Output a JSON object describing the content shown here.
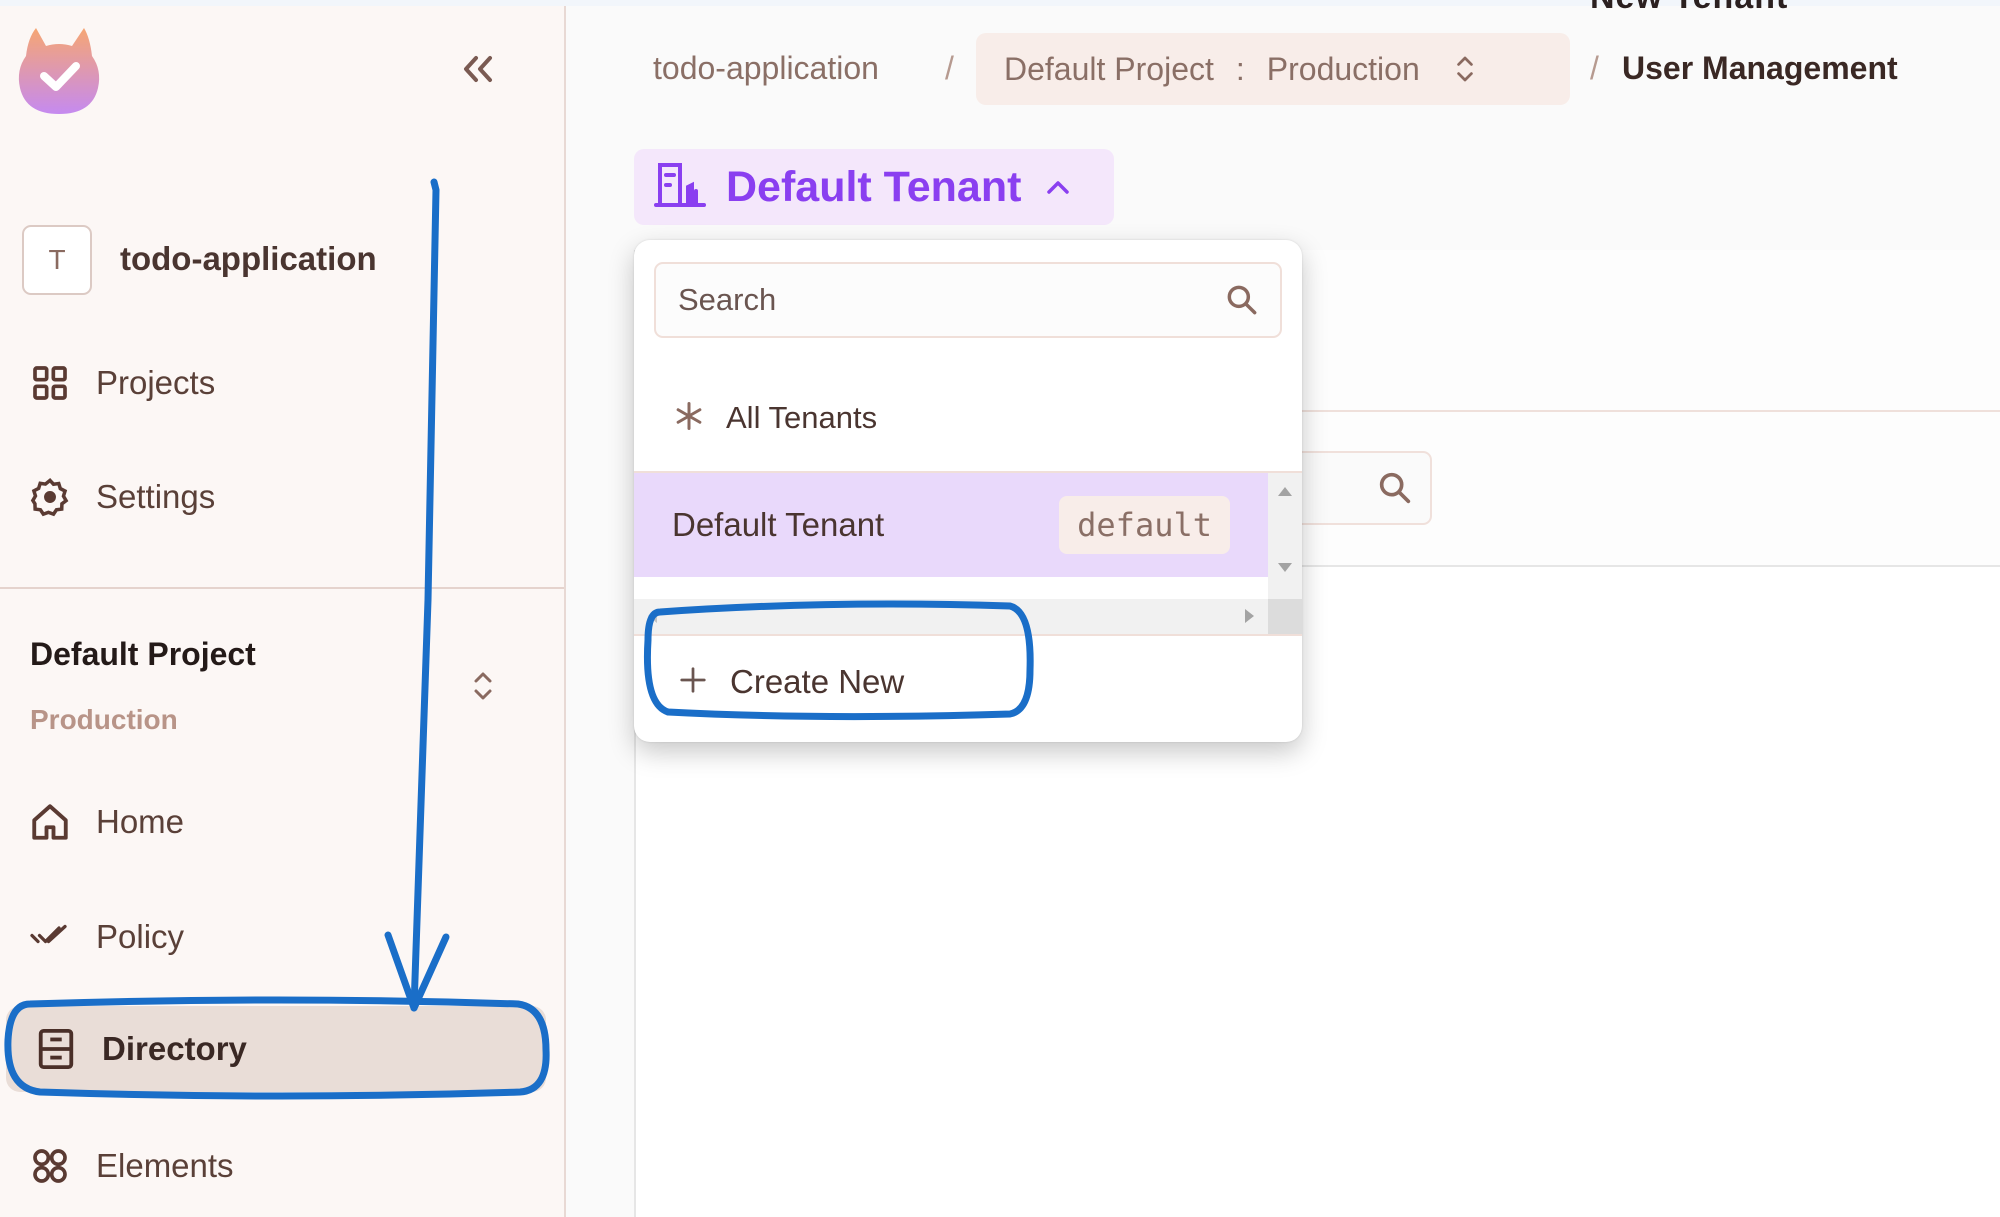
{
  "top_clipped_text": "New Tenant",
  "sidebar": {
    "collapse_icon": "double-chevron-left-icon",
    "org": {
      "avatar_letter": "T",
      "name": "todo-application"
    },
    "org_nav": [
      {
        "label": "Projects",
        "icon": "grid-icon"
      },
      {
        "label": "Settings",
        "icon": "gear-icon"
      }
    ],
    "project": {
      "name": "Default Project",
      "environment": "Production",
      "switch_icon": "chevron-up-down-icon"
    },
    "project_nav": [
      {
        "label": "Home",
        "icon": "home-icon",
        "active": false
      },
      {
        "label": "Policy",
        "icon": "double-check-icon",
        "active": false
      },
      {
        "label": "Directory",
        "icon": "cabinet-icon",
        "active": true
      },
      {
        "label": "Elements",
        "icon": "four-circles-icon",
        "active": false
      }
    ]
  },
  "breadcrumb": {
    "org": "todo-application",
    "separator": "/",
    "project": "Default Project",
    "colon": ":",
    "environment": "Production",
    "current": "User Management"
  },
  "tenant_selector": {
    "label": "Default Tenant",
    "icon": "building-icon",
    "expanded": true
  },
  "tenant_dropdown": {
    "search_placeholder": "Search",
    "all_option": "All Tenants",
    "tenants": [
      {
        "name": "Default Tenant",
        "key": "default",
        "selected": true
      }
    ],
    "create_label": "Create New"
  },
  "colors": {
    "accent_purple": "#8a3ff0",
    "selected_row": "#e9d9fb",
    "sidebar_bg": "#fcf7f5",
    "annotation_blue": "#1a6ec8"
  }
}
